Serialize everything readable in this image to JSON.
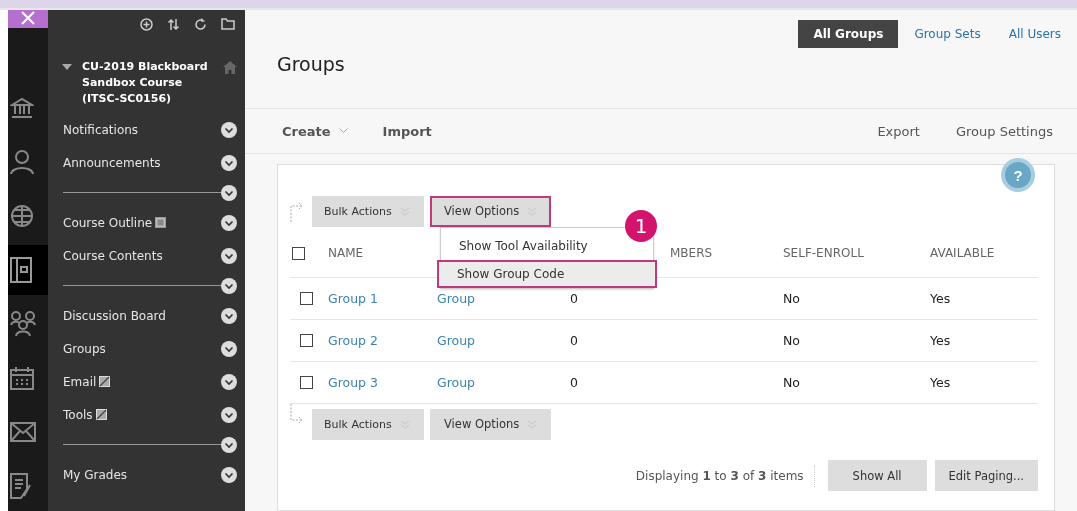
{
  "rail": [
    {
      "selected": false
    },
    {
      "selected": false
    },
    {
      "selected": false
    },
    {
      "selected": true
    },
    {
      "selected": false
    },
    {
      "selected": false
    },
    {
      "selected": false
    },
    {
      "selected": false
    }
  ],
  "course": {
    "title": "CU-2019 Blackboard Sandbox Course (ITSC-SC0156)",
    "expanded": true
  },
  "menu": [
    {
      "kind": "link",
      "label": "Notifications"
    },
    {
      "kind": "link",
      "label": "Announcements"
    },
    {
      "kind": "divider"
    },
    {
      "kind": "link",
      "label": "Course Outline",
      "page_icon": true
    },
    {
      "kind": "link",
      "label": "Course Contents"
    },
    {
      "kind": "divider"
    },
    {
      "kind": "link",
      "label": "Discussion Board"
    },
    {
      "kind": "link",
      "label": "Groups"
    },
    {
      "kind": "link",
      "label": "Email",
      "link_icon": true
    },
    {
      "kind": "link",
      "label": "Tools",
      "link_icon": true
    },
    {
      "kind": "divider"
    },
    {
      "kind": "link",
      "label": "My Grades"
    }
  ],
  "tabs": [
    {
      "label": "All Groups",
      "selected": true
    },
    {
      "label": "Group Sets",
      "selected": false
    },
    {
      "label": "All Users",
      "selected": false
    }
  ],
  "page_title": "Groups",
  "action_bar": {
    "left": [
      {
        "label": "Create",
        "dropdown": true
      },
      {
        "label": "Import",
        "dropdown": false
      }
    ],
    "right": [
      "Export",
      "Group Settings"
    ]
  },
  "help_button": "?",
  "table_actions": [
    {
      "label": "Bulk Actions",
      "highlighted": false
    },
    {
      "label": "View Options",
      "highlighted": true
    }
  ],
  "view_menu": {
    "items": [
      {
        "label": "Show Tool Availability",
        "highlighted": false
      },
      {
        "label": "Show Group Code",
        "highlighted": true
      }
    ],
    "callout": "1"
  },
  "select_all": {
    "checked": false
  },
  "header": {
    "name": "NAME",
    "column_3": "MBERS",
    "self_enroll": "SELF-ENROLL",
    "available": "AVAILABLE"
  },
  "rows": [
    {
      "checked": false,
      "name": "Group 1",
      "column_2": "Group",
      "column_3": "0",
      "self_enroll": "No",
      "available": "Yes"
    },
    {
      "checked": false,
      "name": "Group 2",
      "column_2": "Group",
      "column_3": "0",
      "self_enroll": "No",
      "available": "Yes"
    },
    {
      "checked": false,
      "name": "Group 3",
      "column_2": "Group",
      "column_3": "0",
      "self_enroll": "No",
      "available": "Yes"
    }
  ],
  "bottom_actions": [
    {
      "label": "Bulk Actions"
    },
    {
      "label": "View Options"
    }
  ],
  "paging": {
    "summary": "Displaying **1** to **3** of **3** items",
    "buttons": [
      "Show All",
      "Edit Paging..."
    ]
  }
}
